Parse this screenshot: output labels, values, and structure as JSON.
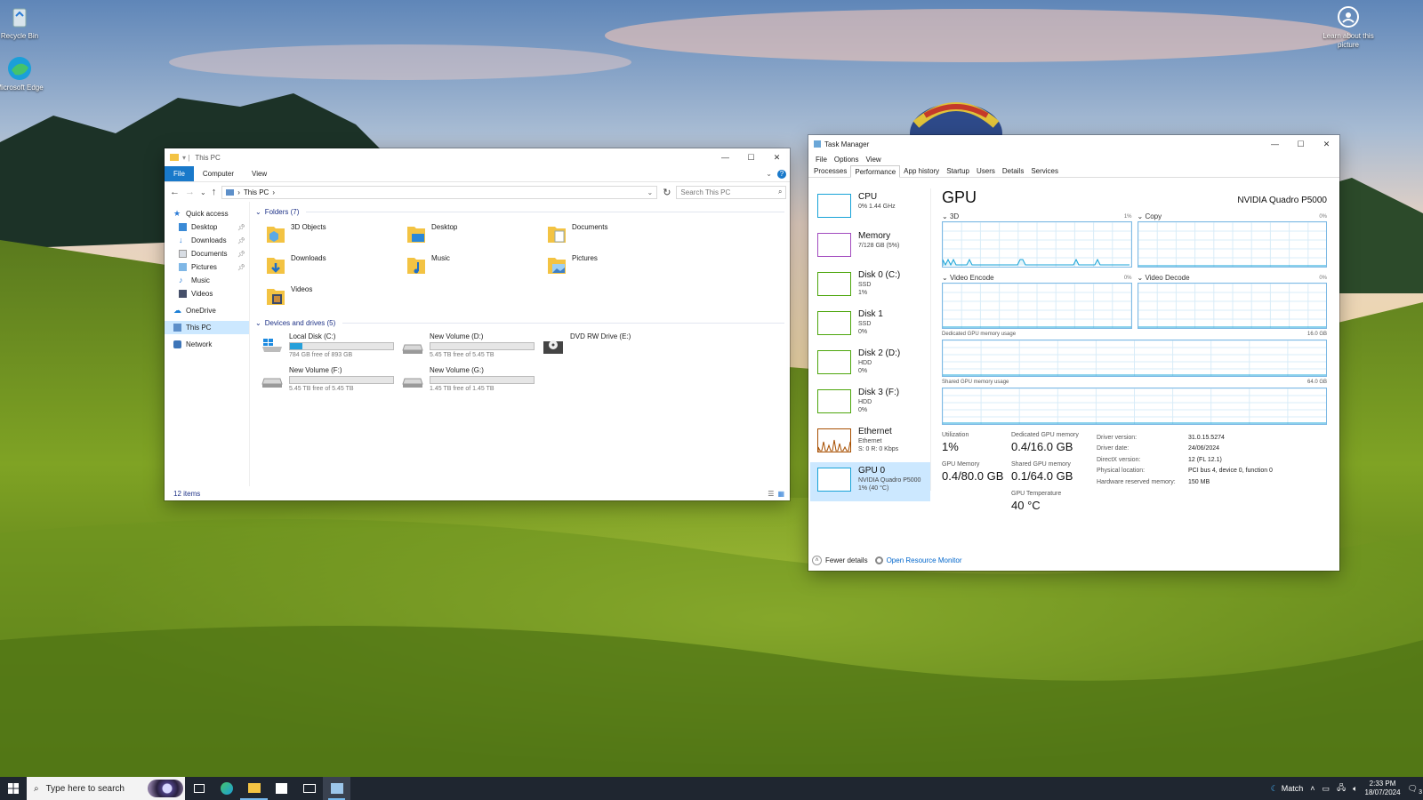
{
  "desktop": {
    "icons": [
      {
        "label": "Recycle Bin"
      },
      {
        "label": "Microsoft Edge"
      },
      {
        "label": "Learn about this picture"
      }
    ]
  },
  "explorer": {
    "title": "This PC",
    "ribbon_tabs": [
      "File",
      "Computer",
      "View"
    ],
    "help_label": "?",
    "address": {
      "crumb": "This PC"
    },
    "search_placeholder": "Search This PC",
    "nav": [
      {
        "label": "Quick access",
        "icon": "star-icon"
      },
      {
        "label": "Desktop",
        "icon": "desktop-folder-icon",
        "pinned": true
      },
      {
        "label": "Downloads",
        "icon": "downloads-folder-icon",
        "pinned": true
      },
      {
        "label": "Documents",
        "icon": "documents-folder-icon",
        "pinned": true
      },
      {
        "label": "Pictures",
        "icon": "pictures-folder-icon",
        "pinned": true
      },
      {
        "label": "Music",
        "icon": "music-folder-icon"
      },
      {
        "label": "Videos",
        "icon": "videos-folder-icon"
      },
      {
        "label": "OneDrive",
        "icon": "onedrive-icon"
      },
      {
        "label": "This PC",
        "icon": "computer-icon"
      },
      {
        "label": "Network",
        "icon": "network-icon"
      }
    ],
    "folders_header": "Folders (7)",
    "folders": [
      "3D Objects",
      "Desktop",
      "Documents",
      "Downloads",
      "Music",
      "Pictures",
      "Videos"
    ],
    "drives_header": "Devices and drives (5)",
    "drives": [
      {
        "name": "Local Disk (C:)",
        "free": "784 GB free of 893 GB",
        "used_fraction": 0.12
      },
      {
        "name": "New Volume (D:)",
        "free": "5.45 TB free of 5.45 TB",
        "used_fraction": 0.0
      },
      {
        "name": "DVD RW Drive (E:)",
        "free": "",
        "used_fraction": null
      },
      {
        "name": "New Volume (F:)",
        "free": "5.45 TB free of 5.45 TB",
        "used_fraction": 0.0
      },
      {
        "name": "New Volume (G:)",
        "free": "1.45 TB free of 1.45 TB",
        "used_fraction": 0.0
      }
    ],
    "status": "12 items"
  },
  "taskmgr": {
    "title": "Task Manager",
    "menu": [
      "File",
      "Options",
      "View"
    ],
    "tabs": [
      "Processes",
      "Performance",
      "App history",
      "Startup",
      "Users",
      "Details",
      "Services"
    ],
    "resources": [
      {
        "name": "CPU",
        "sub1": "0% 1.44 GHz",
        "sub2": "",
        "sub3": "",
        "color": "#17a3d8"
      },
      {
        "name": "Memory",
        "sub1": "7/128 GB (5%)",
        "sub2": "",
        "sub3": "",
        "color": "#a24bbf"
      },
      {
        "name": "Disk 0 (C:)",
        "sub1": "SSD",
        "sub2": "1%",
        "sub3": "",
        "color": "#4da60c"
      },
      {
        "name": "Disk 1",
        "sub1": "SSD",
        "sub2": "0%",
        "sub3": "",
        "color": "#4da60c"
      },
      {
        "name": "Disk 2 (D:)",
        "sub1": "HDD",
        "sub2": "0%",
        "sub3": "",
        "color": "#4da60c"
      },
      {
        "name": "Disk 3 (F:)",
        "sub1": "HDD",
        "sub2": "0%",
        "sub3": "",
        "color": "#4da60c"
      },
      {
        "name": "Ethernet",
        "sub1": "Ethernet",
        "sub2": "S: 0 R: 0 Kbps",
        "sub3": "",
        "color": "#a74f01"
      },
      {
        "name": "GPU 0",
        "sub1": "NVIDIA Quadro P5000",
        "sub2": "1% (40 °C)",
        "sub3": "",
        "color": "#17a3d8"
      }
    ],
    "gpu": {
      "heading": "GPU",
      "model": "NVIDIA Quadro P5000",
      "engines": [
        {
          "label": "3D",
          "pct": "1%"
        },
        {
          "label": "Copy",
          "pct": "0%"
        },
        {
          "label": "Video Encode",
          "pct": "0%"
        },
        {
          "label": "Video Decode",
          "pct": "0%"
        }
      ],
      "dedicated_label": "Dedicated GPU memory usage",
      "dedicated_max": "16.0 GB",
      "shared_label": "Shared GPU memory usage",
      "shared_max": "64.0 GB",
      "stats": [
        {
          "label": "Utilization",
          "value": "1%"
        },
        {
          "label": "Dedicated GPU memory",
          "value": "0.4/16.0 GB"
        },
        {
          "label": "GPU Memory",
          "value": "0.4/80.0 GB"
        },
        {
          "label": "Shared GPU memory",
          "value": "0.1/64.0 GB"
        },
        {
          "label": "",
          "value": ""
        },
        {
          "label": "GPU Temperature",
          "value": "40 °C"
        }
      ],
      "info": [
        {
          "k": "Driver version:",
          "v": "31.0.15.5274"
        },
        {
          "k": "Driver date:",
          "v": "24/06/2024"
        },
        {
          "k": "DirectX version:",
          "v": "12 (FL 12.1)"
        },
        {
          "k": "Physical location:",
          "v": "PCI bus 4, device 0, function 0"
        },
        {
          "k": "Hardware reserved memory:",
          "v": "150 MB"
        }
      ]
    },
    "footer": {
      "fewer": "Fewer details",
      "monitor": "Open Resource Monitor"
    }
  },
  "taskbar": {
    "search_placeholder": "Type here to search",
    "apps": [
      "task-view-icon",
      "edge-icon",
      "file-explorer-icon",
      "store-icon",
      "mail-icon",
      "task-manager-icon"
    ],
    "weather": "Match",
    "time": "2:33 PM",
    "date": "18/07/2024",
    "notifications": "3"
  },
  "colors": {
    "accent": "#1979ca",
    "selection": "#cce8ff",
    "taskbar": "#1f2630",
    "gpu_graph": "#17a3d8"
  }
}
